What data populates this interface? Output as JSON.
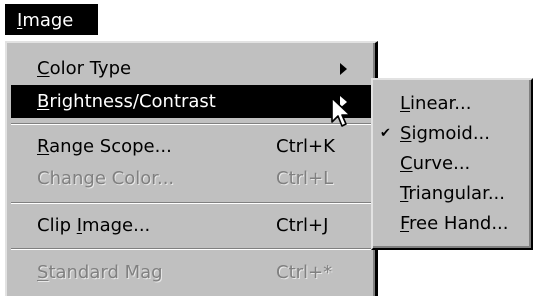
{
  "menubar": {
    "title_mnemonic": "I",
    "title_rest": "mage"
  },
  "main_menu": {
    "color_type": {
      "mn": "C",
      "rest": "olor Type"
    },
    "brightness_contrast": {
      "mn": "B",
      "rest": "rightness/Contrast"
    },
    "range_scope": {
      "mn": "R",
      "rest": "ange Scope...",
      "shortcut": "Ctrl+K"
    },
    "change_color": {
      "label": "Change Color...",
      "shortcut": "Ctrl+L"
    },
    "clip_image": {
      "pre": "Clip ",
      "mn": "I",
      "rest": "mage...",
      "shortcut": "Ctrl+J"
    },
    "standard_mag": {
      "mn": "S",
      "rest": "tandard Mag",
      "shortcut": "Ctrl+*"
    }
  },
  "submenu": {
    "linear": {
      "mn": "L",
      "rest": "inear..."
    },
    "sigmoid": {
      "mn": "S",
      "rest": "igmoid...",
      "checked": true,
      "check_glyph": "✔"
    },
    "curve": {
      "mn": "C",
      "rest": "urve..."
    },
    "triangular": {
      "mn": "T",
      "rest": "riangular..."
    },
    "free_hand": {
      "mn": "F",
      "rest": "ree Hand..."
    }
  }
}
